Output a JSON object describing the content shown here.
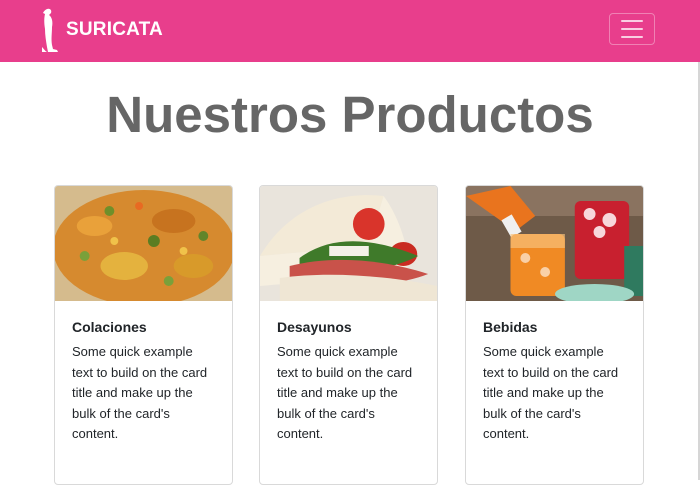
{
  "navbar": {
    "brand": "SURICATA",
    "brand_icon": "meerkat-logo",
    "toggler_icon": "hamburger-icon",
    "color": "#e83e8c"
  },
  "page": {
    "title": "Nuestros Productos"
  },
  "cards": [
    {
      "title": "Colaciones",
      "text": "Some quick example text to build on the card title and make up the bulk of the card's content.",
      "image": "vegetable-dish-photo"
    },
    {
      "title": "Desayunos",
      "text": "Some quick example text to build on the card title and make up the bulk of the card's content.",
      "image": "sandwich-photo"
    },
    {
      "title": "Bebidas",
      "text": "Some quick example text to build on the card title and make up the bulk of the card's content.",
      "image": "drinks-photo"
    }
  ]
}
